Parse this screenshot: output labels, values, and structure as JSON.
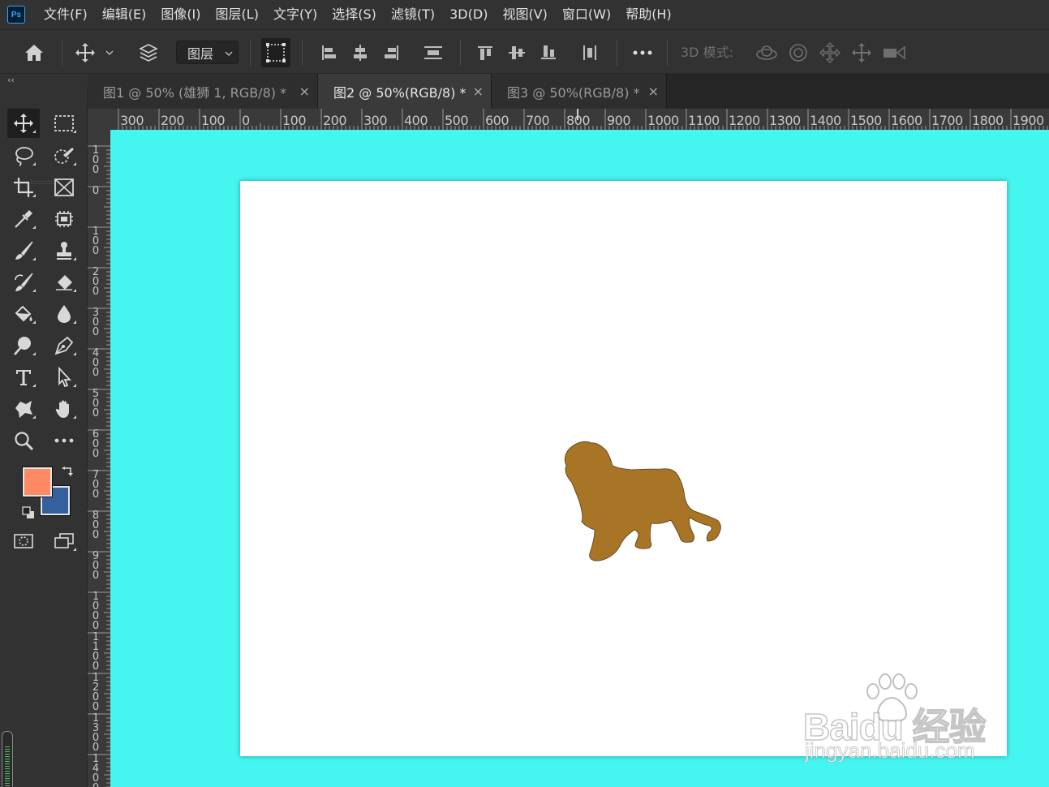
{
  "app": {
    "logo_text": "Ps"
  },
  "menu": [
    "文件(F)",
    "编辑(E)",
    "图像(I)",
    "图层(L)",
    "文字(Y)",
    "选择(S)",
    "滤镜(T)",
    "3D(D)",
    "视图(V)",
    "窗口(W)",
    "帮助(H)"
  ],
  "options_bar": {
    "layer_select_value": "图层",
    "mode_3d_label": "3D 模式:"
  },
  "panel_collapse": "‹‹",
  "tabs": [
    {
      "label": "图1 @ 50% (雄狮 1, RGB/8) *",
      "close": "×",
      "active": false
    },
    {
      "label": "图2 @ 50%(RGB/8) *",
      "close": "×",
      "active": true
    },
    {
      "label": "图3 @ 50%(RGB/8) *",
      "close": "×",
      "active": false
    }
  ],
  "ruler_h_labels": [
    "300",
    "200",
    "100",
    "0",
    "100",
    "200",
    "300",
    "400",
    "500",
    "600",
    "700",
    "800",
    "900",
    "1000",
    "1100",
    "1200",
    "1300",
    "1400",
    "1500",
    "1600",
    "1700",
    "1800",
    "1900"
  ],
  "ruler_v_labels": [
    "0",
    "100",
    "0",
    "100",
    "200",
    "300",
    "400",
    "500",
    "600",
    "700",
    "800",
    "900",
    "1000",
    "1100",
    "1200",
    "1300",
    "1400"
  ],
  "colors": {
    "foreground": "#fd8a62",
    "background": "#34619e",
    "canvas_bg": "#45f5f0",
    "lion": "#a87426"
  },
  "watermark": {
    "brand": "Baidu 经验",
    "url": "jingyan.baidu.com"
  }
}
